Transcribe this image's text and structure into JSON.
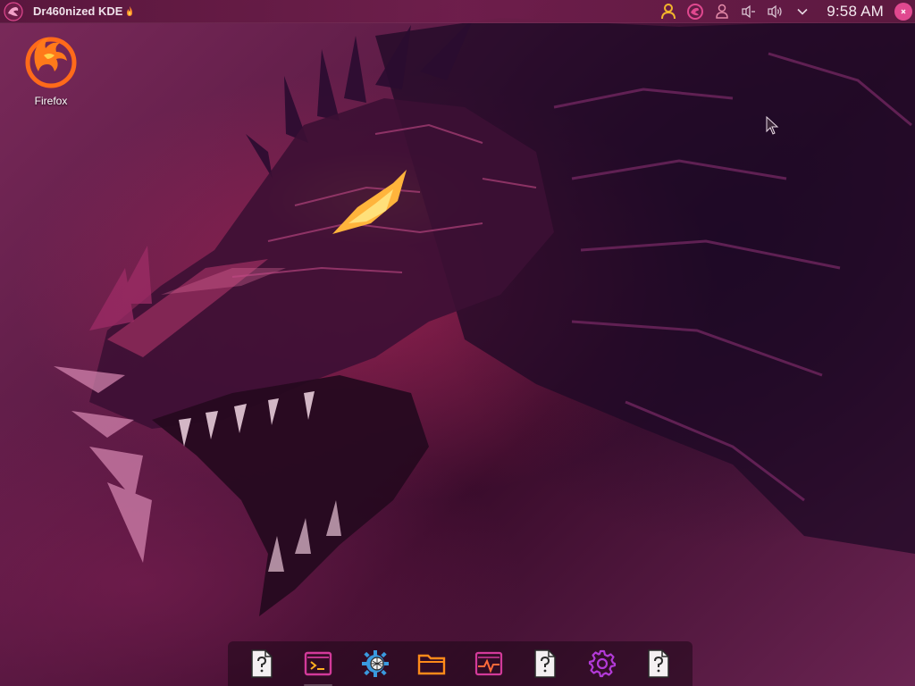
{
  "panel": {
    "app_title": "Dr460nized KDE",
    "title_icon": "fire-icon",
    "clock": "9:58 AM",
    "tray_icons": [
      "user-icon",
      "garuda-assistant-icon",
      "user-accounts-icon",
      "microphone-icon",
      "volume-icon",
      "chevron-down-icon"
    ],
    "accent": "#e0488f"
  },
  "desktop": {
    "icons": [
      {
        "label": "Firefox",
        "icon": "firefox-icon"
      }
    ]
  },
  "dock": {
    "items": [
      {
        "icon": "unknown-file-icon"
      },
      {
        "icon": "terminal-icon"
      },
      {
        "icon": "network-settings-icon"
      },
      {
        "icon": "folder-icon"
      },
      {
        "icon": "system-monitor-icon"
      },
      {
        "icon": "unknown-file-icon"
      },
      {
        "icon": "settings-gear-icon"
      },
      {
        "icon": "unknown-file-icon"
      }
    ]
  },
  "colors": {
    "panel_bg": "#5a163c",
    "wallpaper_base": "#5a1a44",
    "dragon_eye": "#ffb43c",
    "icon_magenta": "#d33a9a",
    "icon_orange": "#ff7a1a"
  }
}
